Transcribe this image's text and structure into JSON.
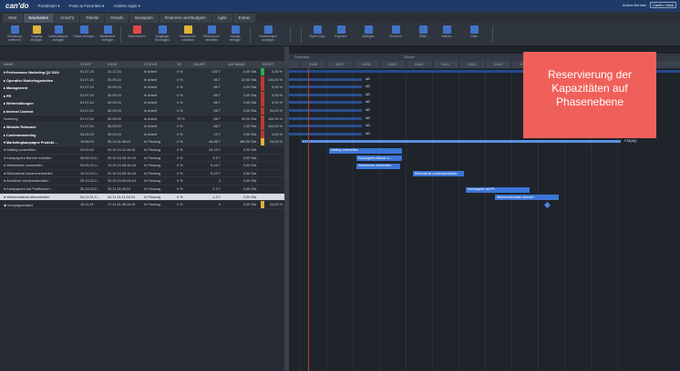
{
  "app": {
    "logo": "can'do",
    "nav": [
      "Portalstart ▾",
      "Posts & Favoriten ▾",
      "Andere Apps ▾"
    ],
    "user": "Ariana Bentani",
    "right_button": "CanDo Clark"
  },
  "tabs": [
    "Start",
    "Bearbeiten",
    "Ansicht",
    "Tabelle",
    "Details",
    "Basisplan",
    "Finanzen und Budgets",
    "Agile",
    "Extras"
  ],
  "active_tab": "Bearbeiten",
  "toolbar": [
    {
      "label": "Gliederung entfernen",
      "color": "#3f73c8"
    },
    {
      "label": "Vorgang einfügen",
      "color": "#e0b437"
    },
    {
      "label": "Unterkategorie einfügen",
      "color": "#3f73c8"
    },
    {
      "label": "Phase einfügen",
      "color": "#3f73c8"
    },
    {
      "label": "Meilenstein einfügen",
      "color": "#3f73c8"
    },
    {
      "label": "Zeile löschen",
      "color": "#e04848"
    },
    {
      "label": "Vorgänger hinzufügen",
      "color": "#3f73c8"
    },
    {
      "label": "Ressourcen zuweisen",
      "color": "#e0b437"
    },
    {
      "label": "Ressourcen verwalten",
      "color": "#3f73c8"
    },
    {
      "label": "Vorlage einfügen",
      "color": "#3f73c8"
    },
    {
      "label": "Zuweisungen anzeigen",
      "color": "#3f73c8"
    },
    {
      "label": "Super-Copy",
      "color": "#3f73c8"
    },
    {
      "label": "Kopieren",
      "color": "#3f73c8"
    },
    {
      "label": "Einfügen",
      "color": "#3f73c8"
    },
    {
      "label": "Stichwort",
      "color": "#3f73c8"
    },
    {
      "label": "Teilen",
      "color": "#3f73c8"
    },
    {
      "label": "Notizen",
      "color": "#3f73c8"
    },
    {
      "label": "Links",
      "color": "#3f73c8"
    }
  ],
  "grid": {
    "headers": [
      "NAME",
      "START",
      "ENDE",
      "STATUS",
      "TE",
      "DAUER",
      "AUFWAND",
      "RESET"
    ],
    "rows": [
      {
        "name": "▾ Performance Marketing Q3 2024",
        "start": "01.07.24",
        "end": "31.12.24",
        "status": "In Arbeit",
        "te": "0 %",
        "dur": "132 T",
        "effort": "0,00 Std.",
        "pct": "0,00 %",
        "flag": "#2fa84f",
        "type": "parent"
      },
      {
        "name": "▸ Operative Marketingarbeiten",
        "start": "01.07.24",
        "end": "30.09.24",
        "status": "In Arbeit",
        "te": "0 %",
        "dur": "66 T",
        "effort": "10,00 Std.",
        "pct": "100,00 %",
        "flag": "#c0392b",
        "type": "parent"
      },
      {
        "name": "▸ Management",
        "start": "01.07.24",
        "end": "30.09.24",
        "status": "In Arbeit",
        "te": "0 %",
        "dur": "66 T",
        "effort": "0,00 Std.",
        "pct": "0,00 %",
        "flag": "#c0392b",
        "type": "parent"
      },
      {
        "name": "▸ PR",
        "start": "01.07.24",
        "end": "30.09.24",
        "status": "In Arbeit",
        "te": "0 %",
        "dur": "66 T",
        "effort": "4,00 Std.",
        "pct": "0,00 %",
        "flag": "#c0392b",
        "type": "parent"
      },
      {
        "name": "▸ Weiterbildungen",
        "start": "01.07.24",
        "end": "30.09.24",
        "status": "In Arbeit",
        "te": "0 %",
        "dur": "66 T",
        "effort": "0,00 Std.",
        "pct": "0,00 %",
        "flag": "#c0392b",
        "type": "parent"
      },
      {
        "name": "▸ Internet Content",
        "start": "01.07.24",
        "end": "30.09.24",
        "status": "In Arbeit",
        "te": "0 %",
        "dur": "66 T",
        "effort": "0,00 Std.",
        "pct": "94,00 %",
        "flag": "#c0392b",
        "type": "parent"
      },
      {
        "name": "   Nurturing",
        "start": "01.07.24",
        "end": "30.09.24",
        "status": "In Arbeit",
        "te": "75 %",
        "dur": "66 T",
        "effort": "20,00 Std.",
        "pct": "100,00 %",
        "flag": "#c0392b",
        "type": "child"
      },
      {
        "name": "▸ Website Relaunch",
        "start": "01.07.24",
        "end": "30.09.24",
        "status": "In Arbeit",
        "te": "0 %",
        "dur": "66 T",
        "effort": "7,00 Std.",
        "pct": "100,00 %",
        "flag": "#c0392b",
        "type": "parent"
      },
      {
        "name": "▸ Contentmarketing",
        "start": "04.09.24",
        "end": "30.09.24",
        "status": "In Arbeit",
        "te": "0 %",
        "dur": "19 T",
        "effort": "4,00 Std.",
        "pct": "0,00 %",
        "flag": "#c0392b",
        "type": "parent"
      },
      {
        "name": "▾ Marketingkampagne Produkt ...",
        "start": "16.08.24",
        "end": "06.11.24-08:24",
        "status": "In Planung",
        "te": "0 %",
        "dur": "48-86 T",
        "effort": "480,00 Std.",
        "pct": "24,00 %",
        "flag": "#e0b437",
        "type": "parent"
      },
      {
        "name": "   ● Mailing vorbereiten",
        "start": "23.09.24",
        "end": "04.10.24-11:16:24",
        "status": "In Planung",
        "te": "0 %",
        "dur": "10-15 T",
        "effort": "0,00 Std.",
        "pct": "",
        "flag": "",
        "type": "child"
      },
      {
        "name": "   ● Kampagnen Banner erstellen",
        "start": "06.09.24-0...",
        "end": "30.10.24-08:16:24",
        "status": "In Planung",
        "te": "0 %",
        "dur": "4-5 T",
        "effort": "0,00 Std.",
        "pct": "",
        "flag": "",
        "type": "child"
      },
      {
        "name": "   ● Werbetexte vorbereiten",
        "start": "09.09.24-1...",
        "end": "19.10.24-08:16:24",
        "status": "In Planung",
        "te": "0 %",
        "dur": "5-16 T",
        "effort": "0,00 Std.",
        "pct": "",
        "flag": "",
        "type": "child"
      },
      {
        "name": "   ● Bildmaterial zusammenstellen",
        "start": "14.10.24-1...",
        "end": "22.10.24-09:16:24",
        "status": "In Planung",
        "te": "0 %",
        "dur": "5-19 T",
        "effort": "0,00 Std.",
        "pct": "",
        "flag": "",
        "type": "child"
      },
      {
        "name": "   ● Abnahme werbematerialien",
        "start": "29.10.24-2...",
        "end": "30.10.24-09:24:24",
        "status": "In Planung",
        "te": "0 %",
        "dur": "2",
        "effort": "0,00 Std.",
        "pct": "",
        "flag": "",
        "type": "child"
      },
      {
        "name": "   ● Kampagnen auf Plattformen ...",
        "start": "30.10.24-0...",
        "end": "25.11.24-09:24",
        "status": "In Planung",
        "te": "0 %",
        "dur": "2-3 T",
        "effort": "0,00 Std.",
        "pct": "",
        "flag": "",
        "type": "child"
      },
      {
        "name": "   ● Werbematerial überarbeiten",
        "start": "04.11.24-0...",
        "end": "04.11.24-11:16:24",
        "status": "In Planung",
        "te": "0 %",
        "dur": "1-4 T",
        "effort": "0,00 Std.",
        "pct": "",
        "flag": "",
        "type": "sel"
      },
      {
        "name": "   ◆ Kampagnenstart",
        "start": "15.11.24",
        "end": "17.11.24-08:16:24",
        "status": "In Planung",
        "te": "0 %",
        "dur": "0",
        "effort": "0,00 Std.",
        "pct": "24,00 %",
        "flag": "#e0b437",
        "type": "child"
      }
    ]
  },
  "gantt": {
    "months": [
      "September",
      "Oktober",
      "November"
    ],
    "weeks": [
      "KW36",
      "KW37",
      "KW38",
      "KW39",
      "KW40",
      "KW41",
      "KW42",
      "KW43",
      "KW44",
      "KW45",
      "KW46",
      "KW47",
      "KW48"
    ],
    "summary_label": "VTA(4Q)",
    "bars": [
      {
        "label": "Mailing vorbereiten",
        "inside": true
      },
      {
        "label": "Kampagnen Banner e...",
        "inside": true
      },
      {
        "label": "Werbetexte vorbereiten",
        "inside": true
      },
      {
        "label": "Bildmaterial zusammenstellen",
        "inside": true
      },
      {
        "label": "Kampagnen auf Pl...",
        "inside": true
      },
      {
        "label": "Werbematerialien überarb...",
        "inside": true
      }
    ],
    "ab_label": "AB"
  },
  "callout": "Reservierung der Kapazitäten auf Phasenebene"
}
